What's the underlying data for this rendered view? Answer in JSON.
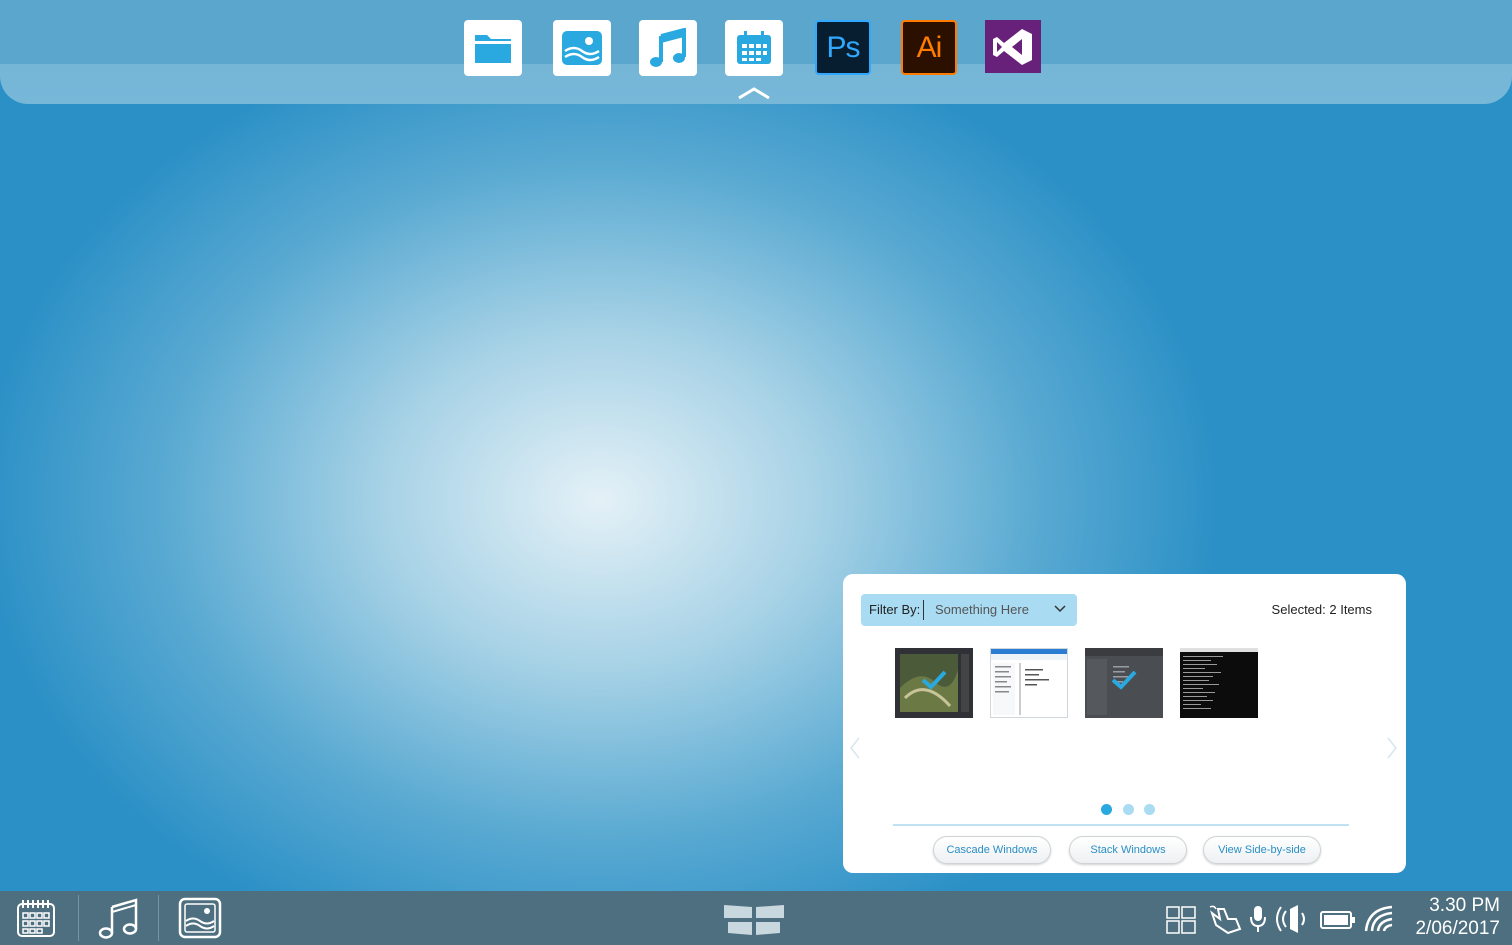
{
  "dock": {
    "apps": [
      {
        "name": "Files",
        "icon": "folder-icon"
      },
      {
        "name": "Photos",
        "icon": "landscape-image-icon"
      },
      {
        "name": "Music",
        "icon": "music-note-icon"
      },
      {
        "name": "Calendar",
        "icon": "calendar-icon"
      },
      {
        "name": "Photoshop",
        "letters": "Ps",
        "bg": "#061e2f",
        "fg": "#31a8ff"
      },
      {
        "name": "Illustrator",
        "letters": "Ai",
        "bg": "#2b1000",
        "fg": "#ff7c00"
      },
      {
        "name": "Visual Studio",
        "icon": "visual-studio-icon",
        "bg": "#68217a"
      }
    ],
    "collapse_icon": "chevron-up-icon"
  },
  "panel": {
    "filter_label": "Filter By:",
    "filter_value": "Something Here",
    "selected_text": "Selected: 2 Items",
    "thumbnails": [
      {
        "name": "photo editor window",
        "selected": true
      },
      {
        "name": "file explorer window",
        "selected": false
      },
      {
        "name": "explorer dark window",
        "selected": true
      },
      {
        "name": "terminal window",
        "selected": false
      }
    ],
    "page_count": 3,
    "active_page": 1,
    "buttons": {
      "cascade": "Cascade Windows",
      "stack": "Stack Windows",
      "side_by_side": "View Side-by-side"
    }
  },
  "taskbar": {
    "pinned": [
      "calendar-icon",
      "music-note-icon",
      "image-icon"
    ],
    "start_icon": "windows-logo-icon",
    "tray": [
      "task-view-icon",
      "touch-icon",
      "microphone-icon",
      "speaker-icon",
      "battery-icon",
      "wifi-icon"
    ],
    "time": "3.30 PM",
    "date": "2/06/2017"
  },
  "colors": {
    "accent": "#29a9e0",
    "taskbar": "#4e6f7f",
    "filter_bg": "#a9dbf2"
  }
}
